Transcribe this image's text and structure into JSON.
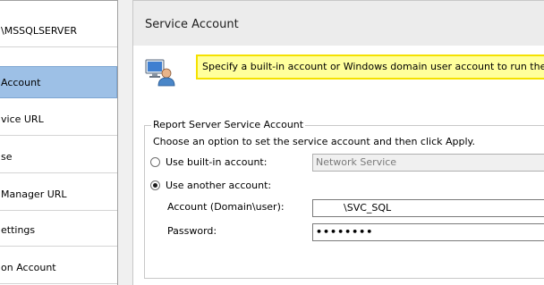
{
  "nav": {
    "items": [
      {
        "label": "\\MSSQLSERVER",
        "selected": false
      },
      {
        "label": "Account",
        "selected": true
      },
      {
        "label": "vice URL",
        "selected": false
      },
      {
        "label": "se",
        "selected": false
      },
      {
        "label": "Manager URL",
        "selected": false
      },
      {
        "label": "ettings",
        "selected": false
      },
      {
        "label": "on Account",
        "selected": false
      }
    ]
  },
  "page": {
    "title": "Service Account",
    "banner_text": "Specify a built-in account or Windows domain user account to run the report se",
    "icon": "user-computer-icon"
  },
  "group": {
    "legend": "Report Server Service Account",
    "instruction": "Choose an option to set the service account and then click Apply.",
    "builtin": {
      "label": "Use built-in account:",
      "checked": false,
      "value": "Network Service"
    },
    "another": {
      "label": "Use another account:",
      "checked": true
    },
    "account": {
      "label": "Account (Domain\\user):",
      "value": "\\SVC_SQL"
    },
    "password": {
      "label": "Password:",
      "value": "••••••••"
    }
  },
  "colors": {
    "selected_nav": "#9dc0e6",
    "banner_bg": "#ffff9c",
    "banner_border": "#f5e100"
  }
}
